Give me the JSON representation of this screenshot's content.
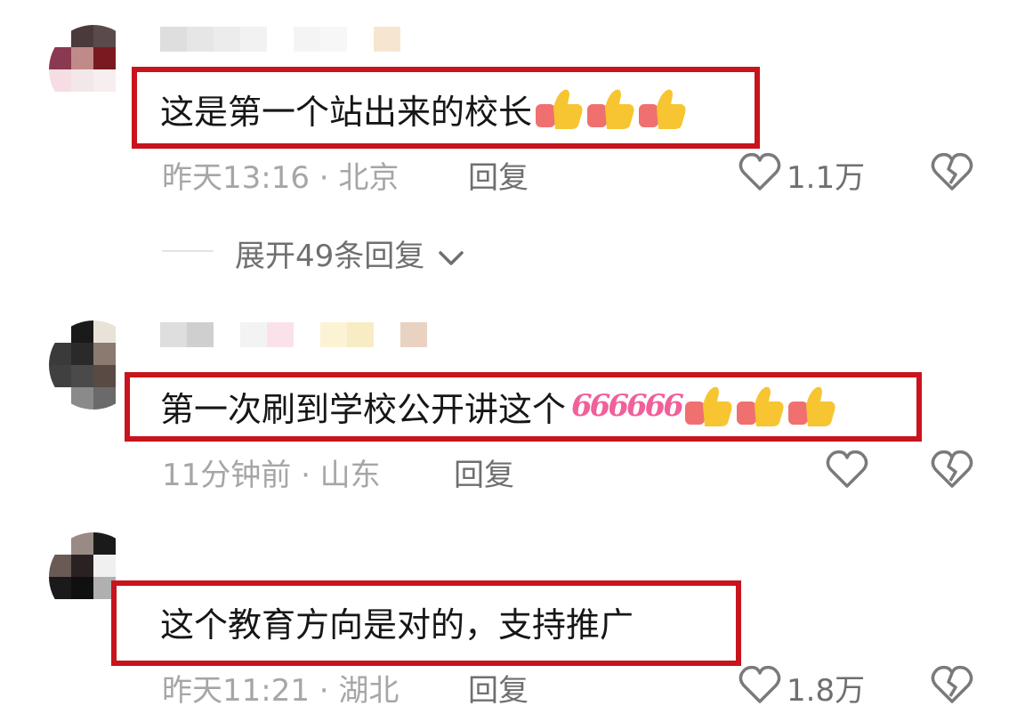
{
  "comments": [
    {
      "text": "这是第一个站出来的校长",
      "time_location": "昨天13:16 · 北京",
      "reply_label": "回复",
      "like_count": "1.1万",
      "expand_replies": "展开49条回复",
      "emoji": [
        "thumbs-up",
        "thumbs-up",
        "thumbs-up"
      ]
    },
    {
      "text": "第一次刷到学校公开讲这个",
      "sixes": "666666",
      "time_location": "11分钟前 · 山东",
      "reply_label": "回复",
      "like_count": "",
      "emoji": [
        "thumbs-up",
        "thumbs-up",
        "thumbs-up"
      ]
    },
    {
      "text": "这个教育方向是对的，支持推广",
      "time_location": "昨天11:21 · 湖北",
      "reply_label": "回复",
      "like_count": "1.8万"
    }
  ],
  "colors": {
    "highlight_border": "#c8141c",
    "meta_text": "#a6a6a6",
    "secondary_text": "#6f6f6f",
    "primary_text": "#161616",
    "six_emoji": "#f0609a"
  },
  "icons": [
    "heart-outline-icon",
    "broken-heart-icon",
    "chevron-down-icon",
    "thumbs-up-emoji"
  ]
}
